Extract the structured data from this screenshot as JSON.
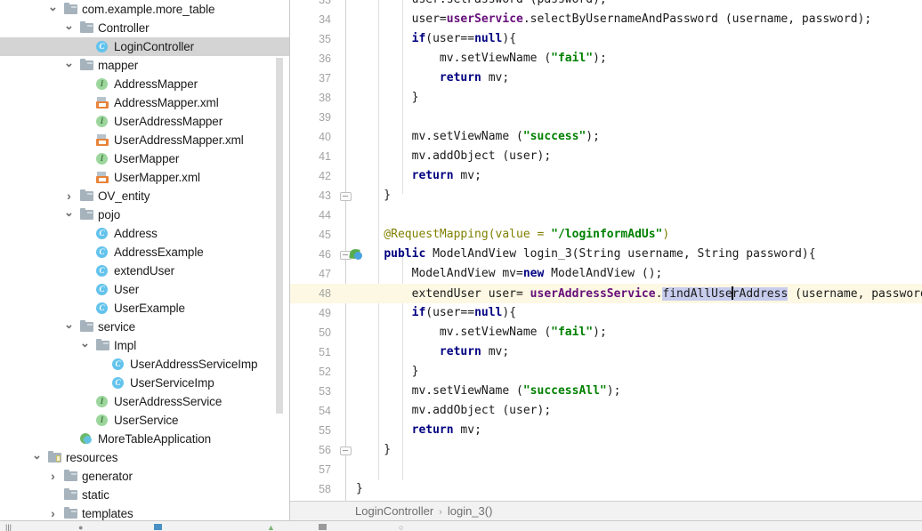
{
  "app": {
    "kind": "ide-code-editor"
  },
  "sidebar": {
    "name": "project-tree",
    "items": [
      {
        "label": "com.example.more_table",
        "icon": "folder-icon",
        "depth": 3,
        "arrow": "down",
        "selected": false
      },
      {
        "label": "Controller",
        "icon": "folder-icon",
        "depth": 4,
        "arrow": "down",
        "selected": false
      },
      {
        "label": "LoginController",
        "icon": "class-icon",
        "depth": 5,
        "arrow": "none",
        "selected": true
      },
      {
        "label": "mapper",
        "icon": "folder-icon",
        "depth": 4,
        "arrow": "down",
        "selected": false
      },
      {
        "label": "AddressMapper",
        "icon": "interface-icon",
        "depth": 5,
        "arrow": "none",
        "selected": false
      },
      {
        "label": "AddressMapper.xml",
        "icon": "xml-icon",
        "depth": 5,
        "arrow": "none",
        "selected": false
      },
      {
        "label": "UserAddressMapper",
        "icon": "interface-icon",
        "depth": 5,
        "arrow": "none",
        "selected": false
      },
      {
        "label": "UserAddressMapper.xml",
        "icon": "xml-icon",
        "depth": 5,
        "arrow": "none",
        "selected": false
      },
      {
        "label": "UserMapper",
        "icon": "interface-icon",
        "depth": 5,
        "arrow": "none",
        "selected": false
      },
      {
        "label": "UserMapper.xml",
        "icon": "xml-icon",
        "depth": 5,
        "arrow": "none",
        "selected": false
      },
      {
        "label": "OV_entity",
        "icon": "folder-icon",
        "depth": 4,
        "arrow": "right",
        "selected": false
      },
      {
        "label": "pojo",
        "icon": "folder-icon",
        "depth": 4,
        "arrow": "down",
        "selected": false
      },
      {
        "label": "Address",
        "icon": "class-icon",
        "depth": 5,
        "arrow": "none",
        "selected": false
      },
      {
        "label": "AddressExample",
        "icon": "class-icon",
        "depth": 5,
        "arrow": "none",
        "selected": false
      },
      {
        "label": "extendUser",
        "icon": "class-icon",
        "depth": 5,
        "arrow": "none",
        "selected": false
      },
      {
        "label": "User",
        "icon": "class-icon",
        "depth": 5,
        "arrow": "none",
        "selected": false
      },
      {
        "label": "UserExample",
        "icon": "class-icon",
        "depth": 5,
        "arrow": "none",
        "selected": false
      },
      {
        "label": "service",
        "icon": "folder-icon",
        "depth": 4,
        "arrow": "down",
        "selected": false
      },
      {
        "label": "Impl",
        "icon": "folder-icon",
        "depth": 5,
        "arrow": "down",
        "selected": false
      },
      {
        "label": "UserAddressServiceImp",
        "icon": "class-icon",
        "depth": 6,
        "arrow": "none",
        "selected": false
      },
      {
        "label": "UserServiceImp",
        "icon": "class-icon",
        "depth": 6,
        "arrow": "none",
        "selected": false
      },
      {
        "label": "UserAddressService",
        "icon": "interface-icon",
        "depth": 5,
        "arrow": "none",
        "selected": false
      },
      {
        "label": "UserService",
        "icon": "interface-icon",
        "depth": 5,
        "arrow": "none",
        "selected": false
      },
      {
        "label": "MoreTableApplication",
        "icon": "spring-app-icon",
        "depth": 4,
        "arrow": "none",
        "selected": false
      },
      {
        "label": "resources",
        "icon": "resources-folder-icon",
        "depth": 2,
        "arrow": "down",
        "selected": false
      },
      {
        "label": "generator",
        "icon": "folder-icon",
        "depth": 3,
        "arrow": "right",
        "selected": false
      },
      {
        "label": "static",
        "icon": "folder-icon",
        "depth": 3,
        "arrow": "none",
        "selected": false
      },
      {
        "label": "templates",
        "icon": "folder-icon",
        "depth": 3,
        "arrow": "right",
        "selected": false
      }
    ]
  },
  "editor": {
    "name": "java-source-editor",
    "first_visible_line": 33,
    "highlighted_line": 48,
    "caret_line": 48,
    "lines": [
      {
        "num": "33",
        "clipped": true,
        "tokens": [
          {
            "t": "        user.setPassword (password);",
            "c": ""
          }
        ]
      },
      {
        "num": "34",
        "tokens": [
          {
            "t": "        user=",
            "c": ""
          },
          {
            "t": "userService",
            "c": "fld"
          },
          {
            "t": ".selectByUsernameAndPassword (username, password);",
            "c": ""
          }
        ]
      },
      {
        "num": "35",
        "tokens": [
          {
            "t": "        ",
            "c": ""
          },
          {
            "t": "if",
            "c": "kw"
          },
          {
            "t": "(user==",
            "c": ""
          },
          {
            "t": "null",
            "c": "kw"
          },
          {
            "t": "){",
            "c": ""
          }
        ]
      },
      {
        "num": "36",
        "tokens": [
          {
            "t": "            mv.setViewName (",
            "c": ""
          },
          {
            "t": "\"fail\"",
            "c": "str"
          },
          {
            "t": ");",
            "c": ""
          }
        ]
      },
      {
        "num": "37",
        "tokens": [
          {
            "t": "            ",
            "c": ""
          },
          {
            "t": "return",
            "c": "kw"
          },
          {
            "t": " mv;",
            "c": ""
          }
        ]
      },
      {
        "num": "38",
        "tokens": [
          {
            "t": "        }",
            "c": ""
          }
        ]
      },
      {
        "num": "39",
        "tokens": [
          {
            "t": "",
            "c": ""
          }
        ]
      },
      {
        "num": "40",
        "tokens": [
          {
            "t": "        mv.setViewName (",
            "c": ""
          },
          {
            "t": "\"success\"",
            "c": "str"
          },
          {
            "t": ");",
            "c": ""
          }
        ]
      },
      {
        "num": "41",
        "tokens": [
          {
            "t": "        mv.addObject (user);",
            "c": ""
          }
        ]
      },
      {
        "num": "42",
        "tokens": [
          {
            "t": "        ",
            "c": ""
          },
          {
            "t": "return",
            "c": "kw"
          },
          {
            "t": " mv;",
            "c": ""
          }
        ]
      },
      {
        "num": "43",
        "fold": true,
        "tokens": [
          {
            "t": "    }",
            "c": ""
          }
        ]
      },
      {
        "num": "44",
        "tokens": [
          {
            "t": "",
            "c": ""
          }
        ]
      },
      {
        "num": "45",
        "tokens": [
          {
            "t": "    @RequestMapping(value = ",
            "c": "ann"
          },
          {
            "t": "\"/loginformAdUs\"",
            "c": "str"
          },
          {
            "t": ")",
            "c": "ann"
          }
        ]
      },
      {
        "num": "46",
        "bean": true,
        "fold": true,
        "tokens": [
          {
            "t": "    ",
            "c": ""
          },
          {
            "t": "public",
            "c": "kw"
          },
          {
            "t": " ModelAndView login_3(String username, String password){",
            "c": ""
          }
        ]
      },
      {
        "num": "47",
        "tokens": [
          {
            "t": "        ModelAndView mv=",
            "c": ""
          },
          {
            "t": "new",
            "c": "kw"
          },
          {
            "t": " ModelAndView ();",
            "c": ""
          }
        ]
      },
      {
        "num": "48",
        "highlight": true,
        "tokens": [
          {
            "t": "        extendUser user= ",
            "c": ""
          },
          {
            "t": "userAddressService",
            "c": "fld"
          },
          {
            "t": ".",
            "c": ""
          },
          {
            "t": "findAllUse",
            "c": "sel"
          },
          {
            "t": "|",
            "c": "caret"
          },
          {
            "t": "rAddress",
            "c": "sel"
          },
          {
            "t": " (username, password);",
            "c": ""
          }
        ]
      },
      {
        "num": "49",
        "tokens": [
          {
            "t": "        ",
            "c": ""
          },
          {
            "t": "if",
            "c": "kw"
          },
          {
            "t": "(user==",
            "c": ""
          },
          {
            "t": "null",
            "c": "kw"
          },
          {
            "t": "){",
            "c": ""
          }
        ]
      },
      {
        "num": "50",
        "tokens": [
          {
            "t": "            mv.setViewName (",
            "c": ""
          },
          {
            "t": "\"fail\"",
            "c": "str"
          },
          {
            "t": ");",
            "c": ""
          }
        ]
      },
      {
        "num": "51",
        "tokens": [
          {
            "t": "            ",
            "c": ""
          },
          {
            "t": "return",
            "c": "kw"
          },
          {
            "t": " mv;",
            "c": ""
          }
        ]
      },
      {
        "num": "52",
        "tokens": [
          {
            "t": "        }",
            "c": ""
          }
        ]
      },
      {
        "num": "53",
        "tokens": [
          {
            "t": "        mv.setViewName (",
            "c": ""
          },
          {
            "t": "\"successAll\"",
            "c": "str"
          },
          {
            "t": ");",
            "c": ""
          }
        ]
      },
      {
        "num": "54",
        "tokens": [
          {
            "t": "        mv.addObject (user);",
            "c": ""
          }
        ]
      },
      {
        "num": "55",
        "tokens": [
          {
            "t": "        ",
            "c": ""
          },
          {
            "t": "return",
            "c": "kw"
          },
          {
            "t": " mv;",
            "c": ""
          }
        ]
      },
      {
        "num": "56",
        "fold": true,
        "tokens": [
          {
            "t": "    }",
            "c": ""
          }
        ]
      },
      {
        "num": "57",
        "tokens": [
          {
            "t": "",
            "c": ""
          }
        ]
      },
      {
        "num": "58",
        "tokens": [
          {
            "t": "}",
            "c": ""
          }
        ]
      }
    ]
  },
  "breadcrumb": {
    "name": "editor-breadcrumb",
    "items": [
      "LoginController",
      "login_3()"
    ],
    "separator": "›"
  },
  "colors": {
    "selection": "#c8cdee",
    "current_line": "#fdf8e3",
    "tree_selected": "#d4d4d4",
    "keyword": "#000080",
    "string": "#008000",
    "annotation": "#808000",
    "field": "#660e7a"
  }
}
